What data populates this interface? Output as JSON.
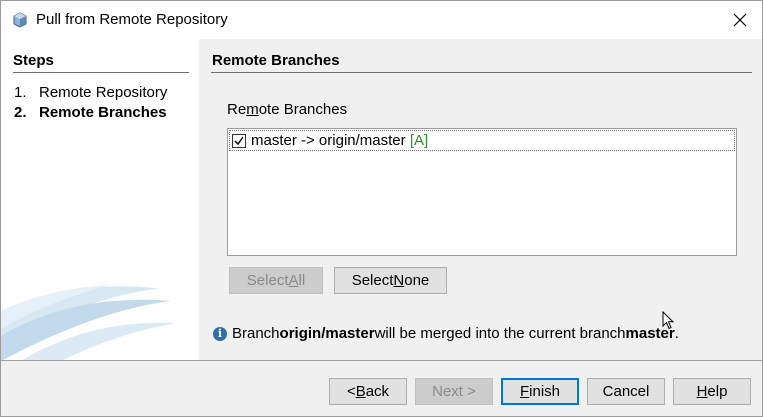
{
  "window": {
    "title": "Pull from Remote Repository",
    "icon": "cube-icon"
  },
  "steps": {
    "heading": "Steps",
    "items": [
      {
        "number": "1.",
        "label": "Remote Repository",
        "current": false
      },
      {
        "number": "2.",
        "label": "Remote Branches",
        "current": true
      }
    ]
  },
  "main": {
    "heading": "Remote Branches",
    "list_label_pre": "Re",
    "list_label_mnemonic": "m",
    "list_label_post": "ote Branches",
    "branches": [
      {
        "checked": true,
        "text": "master -> origin/master",
        "tag": "[A]"
      }
    ],
    "select_all": {
      "pre": "Select ",
      "mnemonic": "A",
      "post": "ll",
      "enabled": false
    },
    "select_none": {
      "pre": "Select ",
      "mnemonic": "N",
      "post": "one",
      "enabled": true
    },
    "info": {
      "pre": "Branch ",
      "remote_branch": "origin/master",
      "mid": " will be merged into the current branch ",
      "local_branch": "master",
      "post": "."
    }
  },
  "footer": {
    "back": {
      "pre": "< ",
      "mnemonic": "B",
      "post": "ack",
      "enabled": true
    },
    "next": {
      "label": "Next >",
      "enabled": false
    },
    "finish": {
      "mnemonic": "F",
      "post": "inish",
      "enabled": true,
      "default": true
    },
    "cancel": {
      "label": "Cancel",
      "enabled": true
    },
    "help": {
      "mnemonic": "H",
      "post": "elp",
      "enabled": true
    }
  },
  "colors": {
    "accent": "#0078d7",
    "tag_green": "#2e8b2e",
    "info_blue": "#2f6ea9"
  }
}
